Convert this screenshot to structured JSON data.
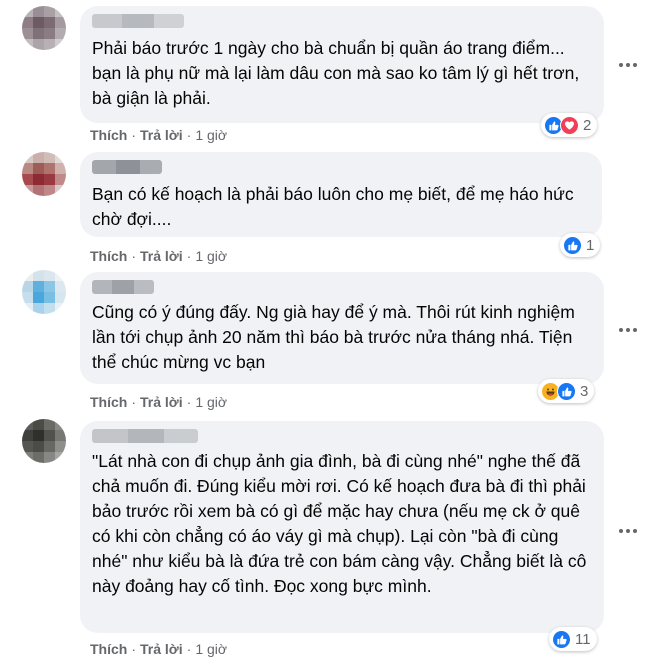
{
  "comments": [
    {
      "text": "Phải báo trước 1 ngày cho bà chuẩn bị quần áo trang điểm... bạn là phụ nữ mà lại làm dâu con mà sao ko tâm lý gì hết trơn, bà giận là phải.",
      "like_label": "Thích",
      "reply_label": "Trả lời",
      "time": "1 giờ",
      "reaction_icons": [
        "like-icon",
        "love-icon"
      ],
      "reaction_count": "2"
    },
    {
      "text": "Bạn có kế hoạch là phải báo luôn cho mẹ biết, để mẹ háo hức chờ đợi....",
      "like_label": "Thích",
      "reply_label": "Trả lời",
      "time": "1 giờ",
      "reaction_icons": [
        "like-icon"
      ],
      "reaction_count": "1"
    },
    {
      "text": "Cũng có ý đúng đấy. Ng già hay để ý mà. Thôi rút kinh nghiệm lần tới chụp ảnh 20 năm thì báo bà trước nửa tháng nhá. Tiện thể chúc mừng vc bạn",
      "like_label": "Thích",
      "reply_label": "Trả lời",
      "time": "1 giờ",
      "reaction_icons": [
        "haha-icon",
        "like-icon"
      ],
      "reaction_count": "3"
    },
    {
      "text": "\"Lát nhà con đi chụp ảnh gia đình, bà đi cùng nhé\" nghe thế đã chả muốn đi. Đúng kiểu mời rơi. Có kế hoạch đưa bà đi thì phải bảo trước rồi xem bà có gì để mặc hay chưa (nếu mẹ ck ở quê có khi còn chẳng có áo váy gì mà chụp). Lại còn \"bà đi cùng nhé\" như kiểu bà là đứa trẻ con bám càng vậy. Chẳng biết là cô này đoảng hay cố tình. Đọc xong bực mình.",
      "like_label": "Thích",
      "reply_label": "Trả lời",
      "time": "1 giờ",
      "reaction_icons": [
        "like-icon"
      ],
      "reaction_count": "11"
    }
  ],
  "colors": {
    "bubble": "#f0f2f5",
    "meta_text": "#65676b",
    "like": "#1877f2",
    "love": "#f33e58",
    "haha": "#f7b125"
  }
}
